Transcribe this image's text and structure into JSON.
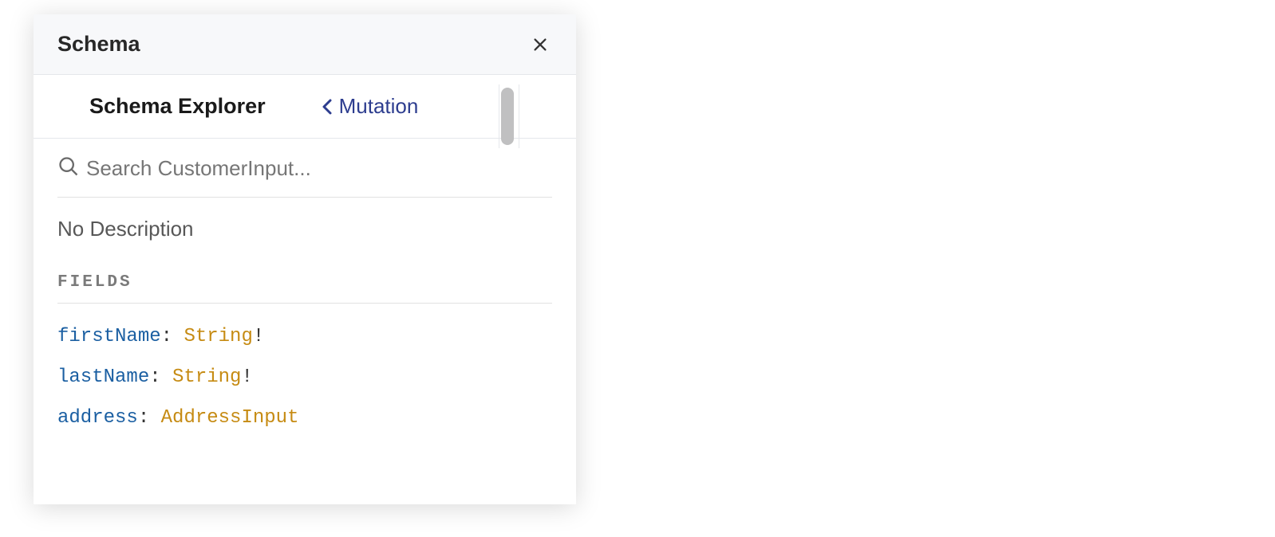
{
  "header": {
    "title": "Schema"
  },
  "nav": {
    "explorer_title": "Schema Explorer",
    "back_label": "Mutation"
  },
  "search": {
    "placeholder": "Search CustomerInput..."
  },
  "description": "No Description",
  "section": {
    "fields_label": "FIELDS"
  },
  "fields": [
    {
      "name": "firstName",
      "type": "String",
      "required": "!"
    },
    {
      "name": "lastName",
      "type": "String",
      "required": "!"
    },
    {
      "name": "address",
      "type": "AddressInput",
      "required": ""
    }
  ]
}
